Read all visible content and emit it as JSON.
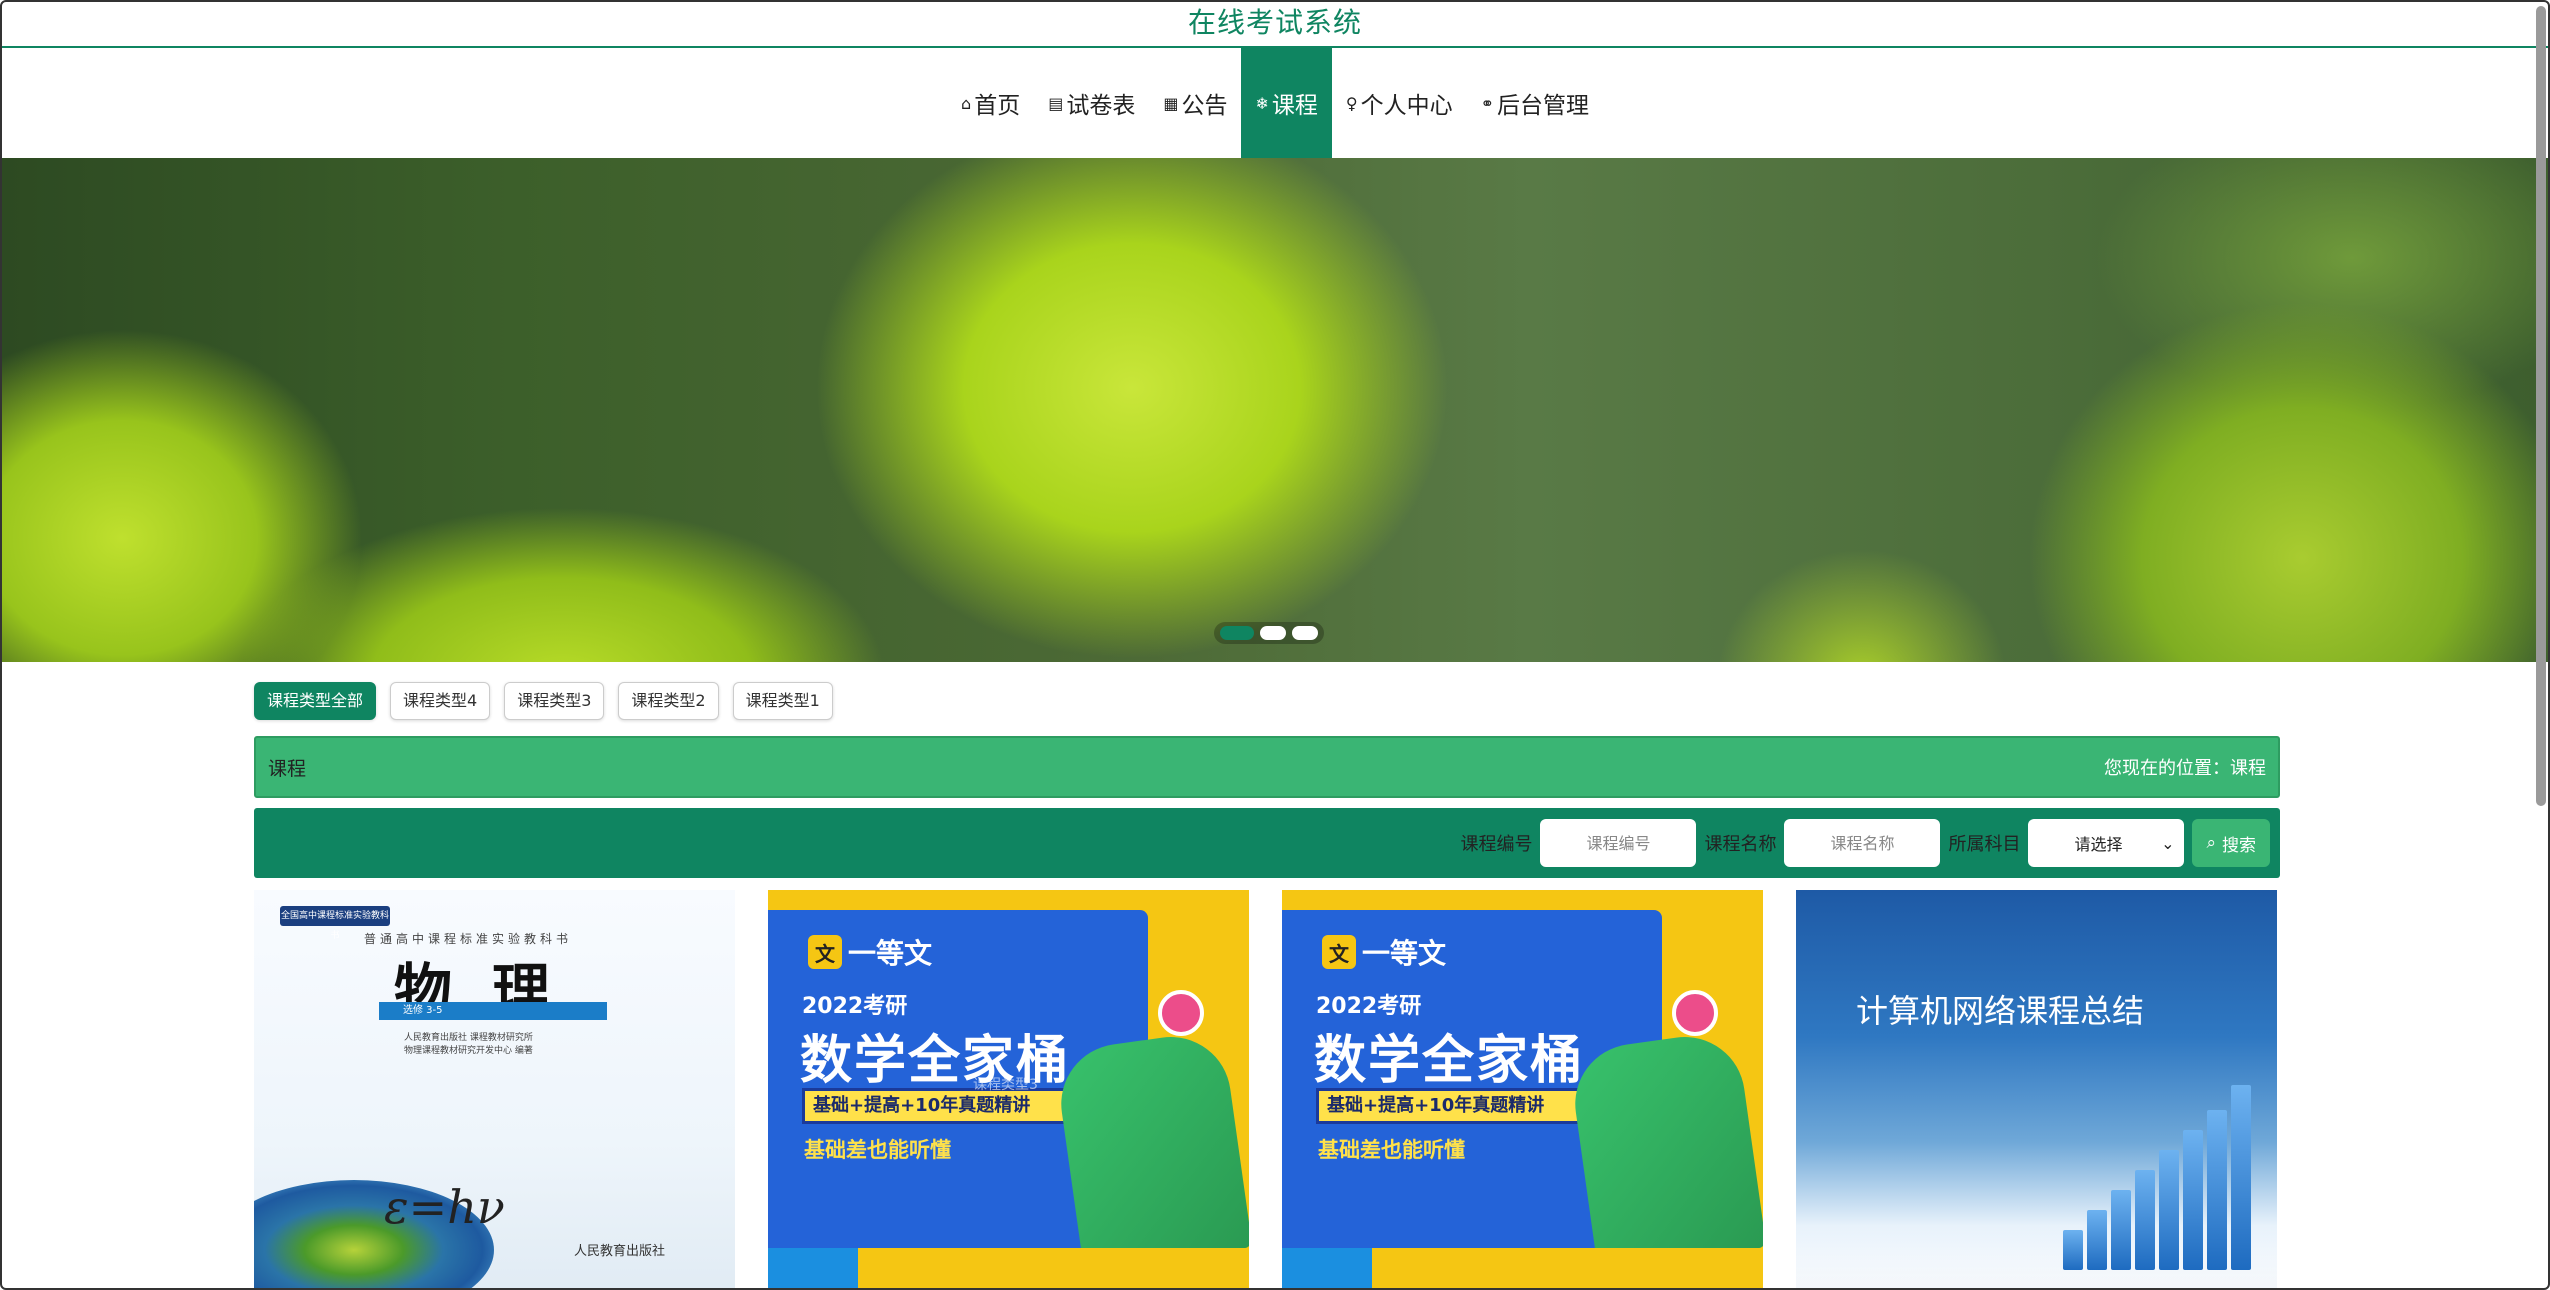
{
  "site": {
    "title": "在线考试系统"
  },
  "nav": {
    "items": [
      {
        "icon": "⌂",
        "label": "首页"
      },
      {
        "icon": "▤",
        "label": "试卷表"
      },
      {
        "icon": "▦",
        "label": "公告"
      },
      {
        "icon": "❄",
        "label": "课程"
      },
      {
        "icon": "♀",
        "label": "个人中心"
      },
      {
        "icon": "⚭",
        "label": "后台管理"
      }
    ],
    "active_index": 3
  },
  "banner": {
    "dots": 3,
    "active_dot": 0
  },
  "course_types": {
    "tabs": [
      "课程类型全部",
      "课程类型4",
      "课程类型3",
      "课程类型2",
      "课程类型1"
    ],
    "active_index": 0
  },
  "breadcrumb": {
    "section": "课程",
    "location_label": "您现在的位置：",
    "location_value": "课程"
  },
  "search": {
    "code_label": "课程编号",
    "code_placeholder": "课程编号",
    "name_label": "课程名称",
    "name_placeholder": "课程名称",
    "subject_label": "所属科目",
    "subject_value": "请选择",
    "button_label": "搜索"
  },
  "cards": {
    "physics": {
      "header": "全国高中课程标准实验教科书",
      "subtitle": "普通高中课程标准实验教科书",
      "title": "物理",
      "volume": "选修 3-5",
      "publisher_line1": "人民教育出版社 课程教材研究所",
      "publisher_line2": "物理课程教材研究开发中心 编著",
      "formula": "ε=hν",
      "press": "人民教育出版社"
    },
    "math1": {
      "brand": "一等文",
      "brand_mark": "文",
      "year": "2022考研",
      "title": "数学全家桶",
      "tagline": "基础+提高+10年真题精讲",
      "slogan": "基础差也能听懂",
      "overlay": "课程类型3"
    },
    "math2": {
      "brand": "一等文",
      "brand_mark": "文",
      "year": "2022考研",
      "title": "数学全家桶",
      "tagline": "基础+提高+10年真题精讲",
      "slogan": "基础差也能听懂"
    },
    "network": {
      "title": "计算机网络课程总结"
    }
  }
}
